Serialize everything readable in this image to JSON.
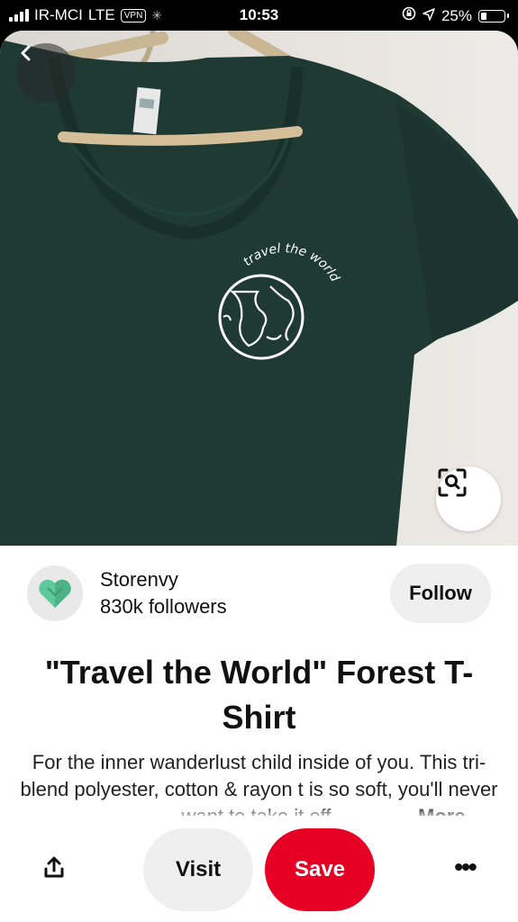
{
  "status_bar": {
    "carrier": "IR-MCI",
    "network": "LTE",
    "vpn": "VPN",
    "time": "10:53",
    "battery": "25%",
    "battery_level": 0.25
  },
  "pin": {
    "image_text": "travel the world",
    "creator": {
      "name": "Storenvy",
      "followers": "830k followers",
      "follow_label": "Follow"
    },
    "title": "\"Travel the World\" Forest T-Shirt",
    "description": "For the inner wanderlust child inside of you. This tri-blend polyester, cotton & rayon t is so soft, you'll never want to take it off.",
    "more_label": "More"
  },
  "actions": {
    "visit_label": "Visit",
    "save_label": "Save",
    "more_icon": "•••"
  },
  "colors": {
    "save": "#e60023",
    "shirt": "#1f3a33",
    "avatar_heart": "#5ec99b"
  }
}
